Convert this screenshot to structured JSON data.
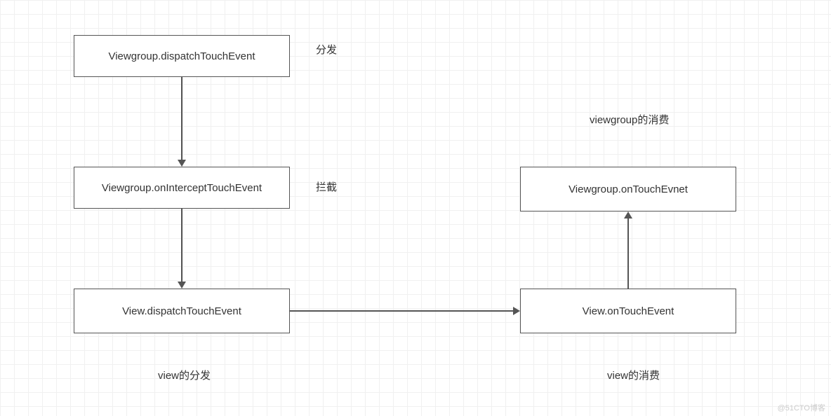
{
  "nodes": {
    "dispatch_vg": "Viewgroup.dispatchTouchEvent",
    "intercept_vg": "Viewgroup.onInterceptTouchEvent",
    "dispatch_view": "View.dispatchTouchEvent",
    "touch_view": "View.onTouchEvent",
    "touch_vg": "Viewgroup.onTouchEvnet"
  },
  "labels": {
    "dispatch": "分发",
    "intercept": "拦截",
    "view_dispatch": "view的分发",
    "view_consume": "view的消费",
    "vg_consume": "viewgroup的消费"
  },
  "watermark": "@51CTO博客"
}
